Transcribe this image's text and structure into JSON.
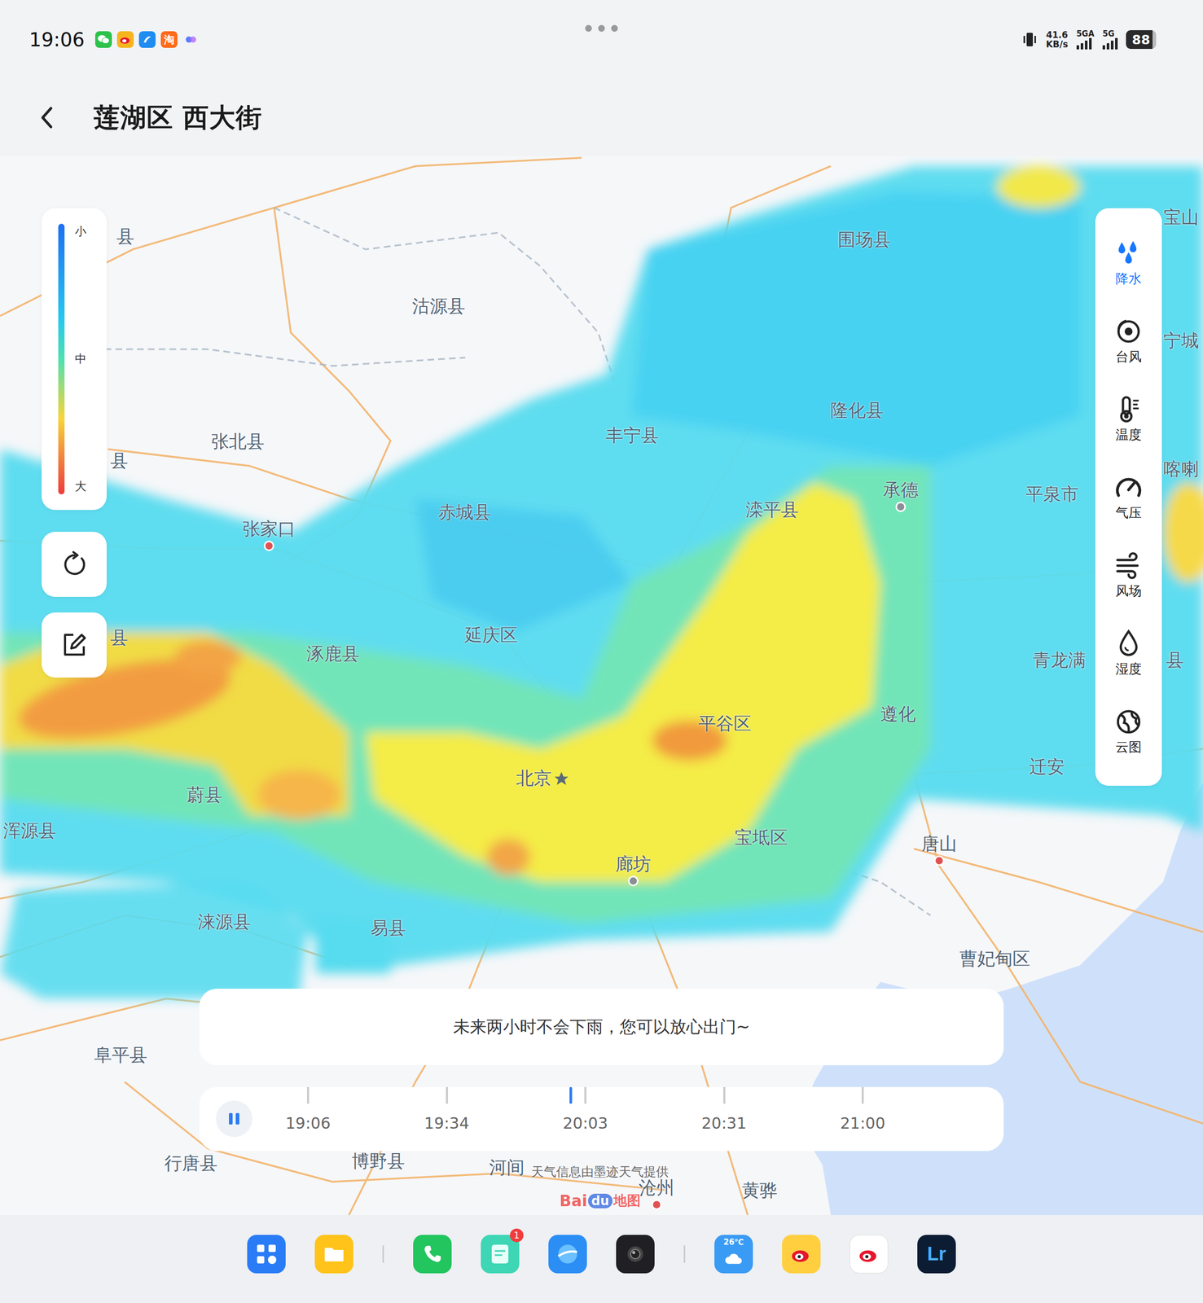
{
  "status_bar": {
    "time": "19:06",
    "notifications": [
      {
        "kind": "wechat"
      },
      {
        "kind": "weibo"
      },
      {
        "kind": "browser"
      },
      {
        "kind": "taobao",
        "label": "淘"
      },
      {
        "kind": "assistant"
      }
    ],
    "net_speed": "41.6",
    "net_unit": "KB/s",
    "sim1": "5GA",
    "sim2": "5G",
    "battery": "88",
    "battery_level": 0.88
  },
  "header": {
    "title": "莲湖区 西大街"
  },
  "legend": {
    "labels": [
      "小",
      "中",
      "大"
    ]
  },
  "layers": [
    {
      "label": "降水",
      "kind": "rain",
      "selected": true
    },
    {
      "label": "台风",
      "kind": "typhoon",
      "selected": false
    },
    {
      "label": "温度",
      "kind": "temperature",
      "selected": false
    },
    {
      "label": "气压",
      "kind": "pressure",
      "selected": false
    },
    {
      "label": "风场",
      "kind": "wind",
      "selected": false
    },
    {
      "label": "湿度",
      "kind": "humidity",
      "selected": false
    },
    {
      "label": "云图",
      "kind": "cloud",
      "selected": false
    }
  ],
  "map_labels": [
    {
      "text": "县",
      "kind": "place"
    },
    {
      "text": "沽源县",
      "kind": "place"
    },
    {
      "text": "张北县",
      "kind": "place"
    },
    {
      "text": "县",
      "kind": "place"
    },
    {
      "text": "张家口",
      "kind": "city"
    },
    {
      "text": "赤城县",
      "kind": "place"
    },
    {
      "text": "丰宁县",
      "kind": "place"
    },
    {
      "text": "围场县",
      "kind": "place"
    },
    {
      "text": "隆化县",
      "kind": "place"
    },
    {
      "text": "承德",
      "kind": "city"
    },
    {
      "text": "滦平县",
      "kind": "place"
    },
    {
      "text": "平泉市",
      "kind": "place"
    },
    {
      "text": "宝山",
      "kind": "place"
    },
    {
      "text": "宁城",
      "kind": "place"
    },
    {
      "text": "喀喇",
      "kind": "place"
    },
    {
      "text": "青龙满",
      "kind": "place"
    },
    {
      "text": "县",
      "kind": "place"
    },
    {
      "text": "县",
      "kind": "place"
    },
    {
      "text": "涿鹿县",
      "kind": "place"
    },
    {
      "text": "延庆区",
      "kind": "place"
    },
    {
      "text": "平谷区",
      "kind": "place"
    },
    {
      "text": "遵化",
      "kind": "place"
    },
    {
      "text": "迁安",
      "kind": "place"
    },
    {
      "text": "北京",
      "kind": "capital"
    },
    {
      "text": "蔚县",
      "kind": "place"
    },
    {
      "text": "浑源县",
      "kind": "place"
    },
    {
      "text": "宝坻区",
      "kind": "place"
    },
    {
      "text": "唐山",
      "kind": "city"
    },
    {
      "text": "廊坊",
      "kind": "city"
    },
    {
      "text": "涞源县",
      "kind": "place"
    },
    {
      "text": "易县",
      "kind": "place"
    },
    {
      "text": "曹妃甸区",
      "kind": "place"
    },
    {
      "text": "阜平县",
      "kind": "place"
    },
    {
      "text": "行唐县",
      "kind": "place"
    },
    {
      "text": "博野县",
      "kind": "place"
    },
    {
      "text": "河间",
      "kind": "place"
    },
    {
      "text": "沧州",
      "kind": "city"
    },
    {
      "text": "黄骅",
      "kind": "place"
    }
  ],
  "message": "未来两小时不会下雨，您可以放心出门~",
  "timeline": {
    "playing": true,
    "level": 0.474,
    "ticks": [
      "19:06",
      "19:34",
      "20:03",
      "20:31",
      "21:00"
    ]
  },
  "attribution": "天气信息由墨迹天气提供",
  "baidu": {
    "a": "Bai",
    "b": "du",
    "c": "地图"
  },
  "dock": [
    {
      "kind": "launcher"
    },
    {
      "kind": "files"
    },
    {
      "kind": "separator"
    },
    {
      "kind": "phone"
    },
    {
      "kind": "notes",
      "badge": "1"
    },
    {
      "kind": "browser"
    },
    {
      "kind": "camera"
    },
    {
      "kind": "separator"
    },
    {
      "kind": "weather",
      "label": "26℃"
    },
    {
      "kind": "weibo"
    },
    {
      "kind": "weibo-lite"
    },
    {
      "kind": "lightroom",
      "label": "Lr"
    }
  ]
}
